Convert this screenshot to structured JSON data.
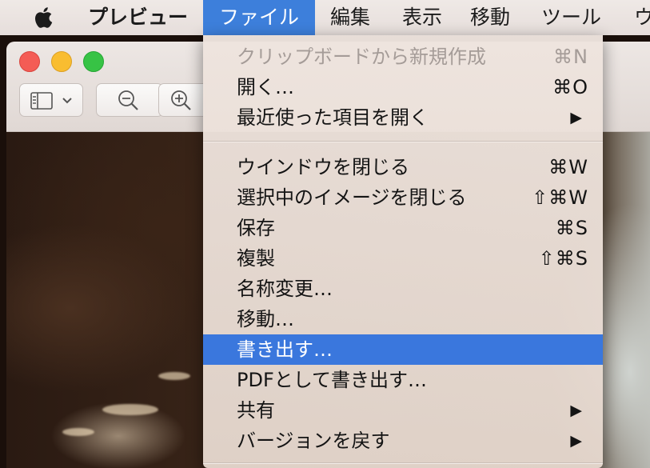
{
  "menubar": {
    "app_name": "プレビュー",
    "items": [
      "ファイル",
      "編集",
      "表示",
      "移動",
      "ツール",
      "ウ"
    ]
  },
  "menu": {
    "group1": [
      {
        "label": "クリップボードから新規作成",
        "shortcut": "⌘N"
      },
      {
        "label": "開く…",
        "shortcut": "⌘O"
      },
      {
        "label": "最近使った項目を開く",
        "arrow": "▶"
      }
    ],
    "group2": [
      {
        "label": "ウインドウを閉じる",
        "shortcut": "⌘W"
      },
      {
        "label": "選択中のイメージを閉じる",
        "shortcut": "⇧⌘W"
      },
      {
        "label": "保存",
        "shortcut": "⌘S"
      },
      {
        "label": "複製",
        "shortcut": "⇧⌘S"
      },
      {
        "label": "名称変更…"
      },
      {
        "label": "移動…"
      },
      {
        "label": "書き出す…"
      },
      {
        "label": "PDFとして書き出す…"
      },
      {
        "label": "共有",
        "arrow": "▶"
      },
      {
        "label": "バージョンを戻す",
        "arrow": "▶"
      }
    ]
  },
  "colors": {
    "highlight": "#3a77dd",
    "disabled_text": "#a59c98"
  },
  "icons": {
    "apple": "apple-icon",
    "sidebar": "sidebar-icon",
    "zoom_out": "zoom-out-icon",
    "zoom_in": "zoom-in-icon"
  }
}
